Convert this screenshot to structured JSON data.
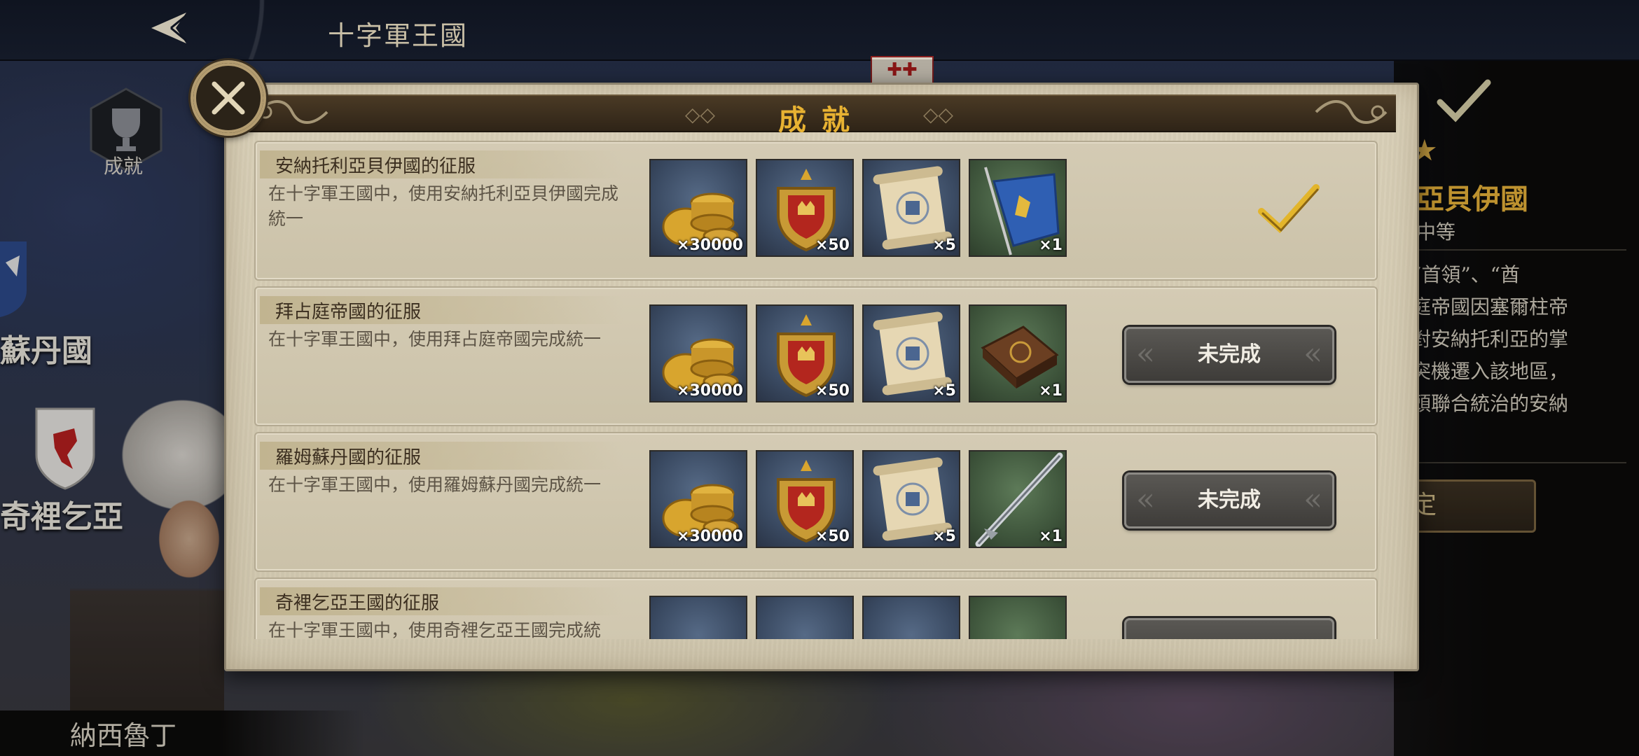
{
  "top_bar": {
    "kingdom_title": "十字軍王國"
  },
  "map": {
    "achievements_label": "成就",
    "labels": [
      "蘇丹國",
      "奇裡乞亞"
    ],
    "leader_name": "納西魯丁"
  },
  "right_panel": {
    "title": "亞貝伊國",
    "difficulty": "中等",
    "description_lines": [
      "“首領”、“酋",
      "庭帝國因塞爾柱帝",
      "對安納托利亞的掌",
      "突機遷入該地區，",
      "頭聯合統治的安納"
    ],
    "button_label": "定"
  },
  "modal": {
    "title": "成就",
    "close_label": "close",
    "achievements": [
      {
        "title": "安納托利亞貝伊國的征服",
        "description": "在十字軍王國中，使用安納托利亞貝伊國完成統一",
        "rewards": [
          {
            "icon": "gold-coins-icon",
            "count": "×30000"
          },
          {
            "icon": "crest-badge-icon",
            "count": "×50"
          },
          {
            "icon": "scroll-icon",
            "count": "×5"
          },
          {
            "icon": "blue-banner-icon",
            "count": "×1"
          }
        ],
        "status": "completed"
      },
      {
        "title": "拜占庭帝國的征服",
        "description": "在十字軍王國中，使用拜占庭帝國完成統一",
        "rewards": [
          {
            "icon": "gold-coins-icon",
            "count": "×30000"
          },
          {
            "icon": "crest-badge-icon",
            "count": "×50"
          },
          {
            "icon": "scroll-icon",
            "count": "×5"
          },
          {
            "icon": "tome-icon",
            "count": "×1"
          }
        ],
        "status": "未完成"
      },
      {
        "title": "羅姆蘇丹國的征服",
        "description": "在十字軍王國中，使用羅姆蘇丹國完成統一",
        "rewards": [
          {
            "icon": "gold-coins-icon",
            "count": "×30000"
          },
          {
            "icon": "crest-badge-icon",
            "count": "×50"
          },
          {
            "icon": "scroll-icon",
            "count": "×5"
          },
          {
            "icon": "lance-icon",
            "count": "×1"
          }
        ],
        "status": "未完成"
      },
      {
        "title": "奇裡乞亞王國的征服",
        "description": "在十字軍王國中，使用奇裡乞亞王國完成統",
        "rewards": [],
        "status": ""
      }
    ]
  },
  "colors": {
    "accent_gold": "#e8b232",
    "parchment": "#d9d0b8",
    "button_grey": "#4a4845"
  }
}
